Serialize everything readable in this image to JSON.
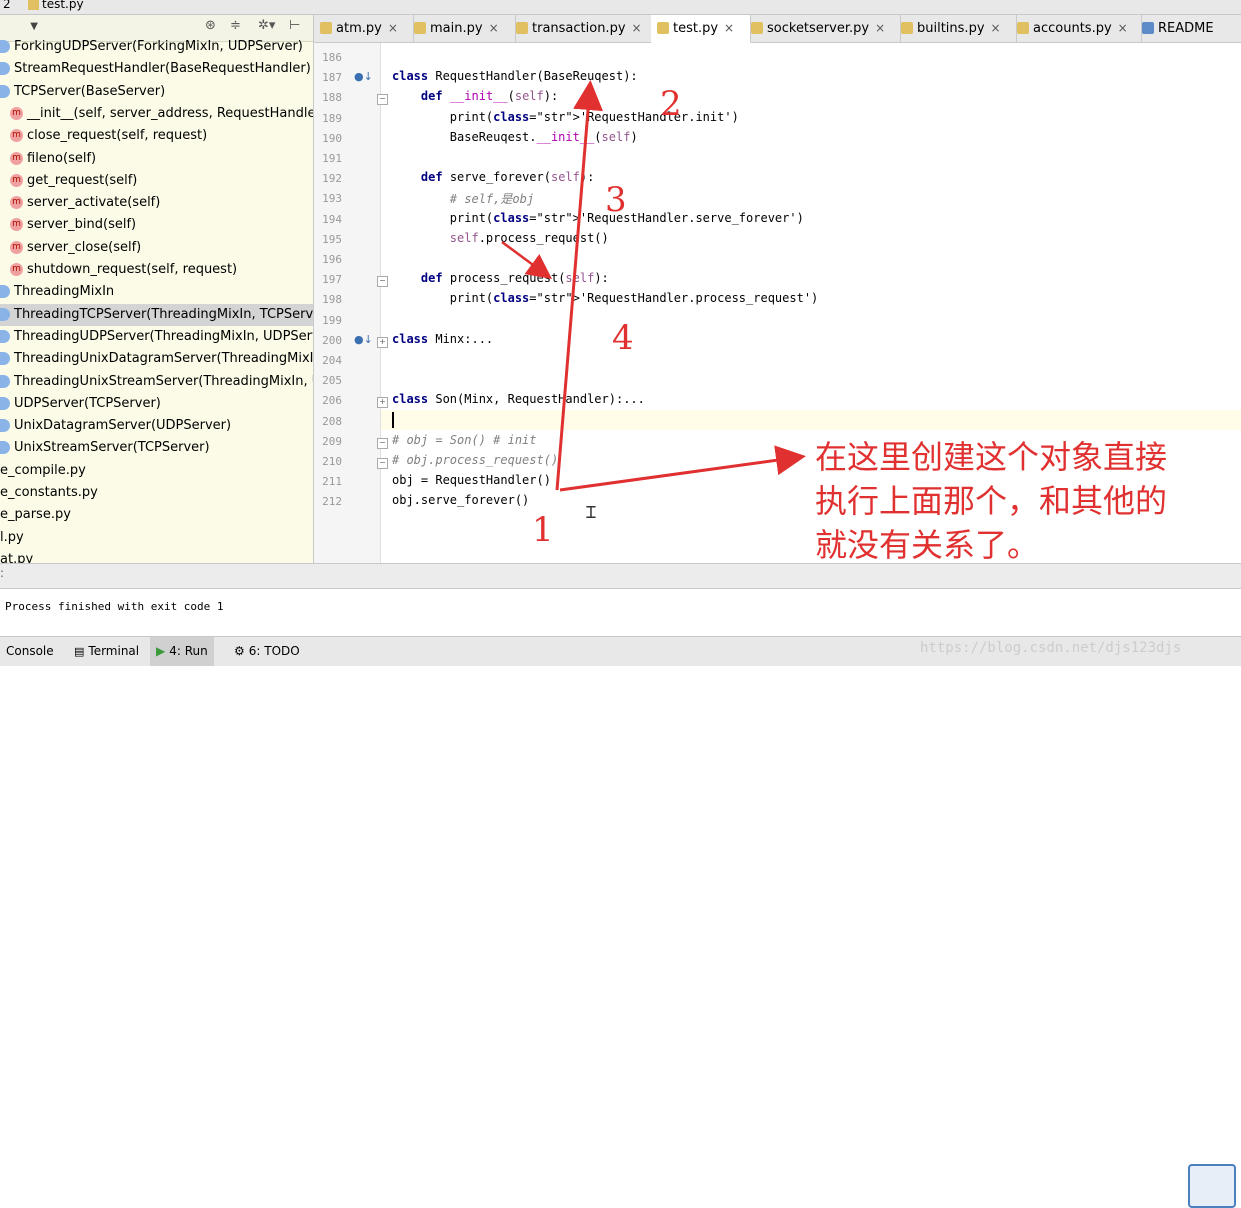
{
  "topbar": {
    "crumb": "2",
    "file": "test.py"
  },
  "sidebar": {
    "items": [
      {
        "label": "ForkingUDPServer(ForkingMixIn, UDPServer)",
        "kind": "class"
      },
      {
        "label": "StreamRequestHandler(BaseRequestHandler)",
        "kind": "class"
      },
      {
        "label": "TCPServer(BaseServer)",
        "kind": "class"
      },
      {
        "label": "__init__(self, server_address, RequestHandlerCl",
        "kind": "method"
      },
      {
        "label": "close_request(self, request)",
        "kind": "method"
      },
      {
        "label": "fileno(self)",
        "kind": "method"
      },
      {
        "label": "get_request(self)",
        "kind": "method"
      },
      {
        "label": "server_activate(self)",
        "kind": "method"
      },
      {
        "label": "server_bind(self)",
        "kind": "method"
      },
      {
        "label": "server_close(self)",
        "kind": "method"
      },
      {
        "label": "shutdown_request(self, request)",
        "kind": "method"
      },
      {
        "label": "ThreadingMixIn",
        "kind": "class"
      },
      {
        "label": "ThreadingTCPServer(ThreadingMixIn, TCPServer)",
        "kind": "class",
        "selected": true
      },
      {
        "label": "ThreadingUDPServer(ThreadingMixIn, UDPServer",
        "kind": "class"
      },
      {
        "label": "ThreadingUnixDatagramServer(ThreadingMixIn, U",
        "kind": "class"
      },
      {
        "label": "ThreadingUnixStreamServer(ThreadingMixIn, Unix",
        "kind": "class"
      },
      {
        "label": "UDPServer(TCPServer)",
        "kind": "class"
      },
      {
        "label": "UnixDatagramServer(UDPServer)",
        "kind": "class"
      },
      {
        "label": "UnixStreamServer(TCPServer)",
        "kind": "class"
      },
      {
        "label": "e_compile.py",
        "kind": "file"
      },
      {
        "label": "e_constants.py",
        "kind": "file"
      },
      {
        "label": "e_parse.py",
        "kind": "file"
      },
      {
        "label": "l.py",
        "kind": "file"
      },
      {
        "label": "at.py",
        "kind": "file"
      }
    ],
    "toolbar_icons": [
      "target-icon",
      "collapse-icon",
      "gear-icon",
      "pin-icon"
    ]
  },
  "tabs": [
    {
      "label": "atm.py",
      "active": false
    },
    {
      "label": "main.py",
      "active": false
    },
    {
      "label": "transaction.py",
      "active": false
    },
    {
      "label": "test.py",
      "active": true
    },
    {
      "label": "socketserver.py",
      "active": false
    },
    {
      "label": "builtins.py",
      "active": false
    },
    {
      "label": "accounts.py",
      "active": false
    },
    {
      "label": "README",
      "active": false
    }
  ],
  "editor": {
    "line_numbers": [
      "186",
      "187",
      "188",
      "189",
      "190",
      "191",
      "192",
      "193",
      "194",
      "195",
      "196",
      "197",
      "198",
      "199",
      "200",
      "204",
      "205",
      "206",
      "208",
      "209",
      "210",
      "211",
      "212"
    ],
    "lines": [
      "",
      "class RequestHandler(BaseReuqest):",
      "    def __init__(self):",
      "        print('RequestHandler.init')",
      "        BaseReuqest.__init__(self)",
      "",
      "    def serve_forever(self):",
      "        # self,是obj",
      "        print('RequestHandler.serve_forever')",
      "        self.process_request()",
      "",
      "    def process_request(self):",
      "        print('RequestHandler.process_request')",
      "",
      "class Minx:...",
      "",
      "",
      "class Son(Minx, RequestHandler):...",
      "",
      "# obj = Son() # init",
      "# obj.process_request()",
      "obj = RequestHandler()",
      "obj.serve_forever()"
    ]
  },
  "annotations": {
    "numbers": [
      "1",
      "2",
      "3",
      "4"
    ],
    "note_lines": [
      "在这里创建这个对象直接",
      "执行上面那个，和其他的",
      "就没有关系了。"
    ],
    "color": "#e03030"
  },
  "run": {
    "output": "Process finished with exit code 1"
  },
  "bottom_tabs": [
    {
      "label": "Console"
    },
    {
      "label": "Terminal"
    },
    {
      "label": "4: Run",
      "active": true
    },
    {
      "label": "6: TODO"
    }
  ],
  "watermark": "https://blog.csdn.net/djs123djs"
}
